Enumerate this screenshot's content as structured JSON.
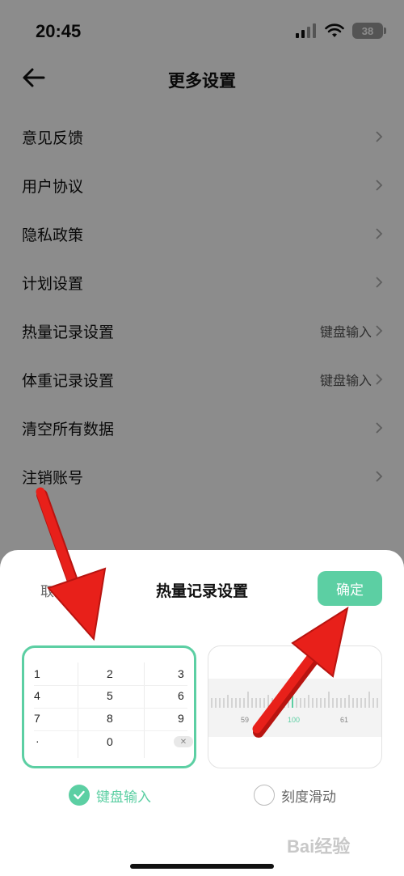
{
  "status_bar": {
    "time": "20:45",
    "battery": "38",
    "icons": [
      "signal-icon",
      "wifi-icon",
      "battery-icon"
    ]
  },
  "header": {
    "title": "更多设置",
    "back_icon": "back-arrow-icon"
  },
  "settings": [
    {
      "label": "意见反馈",
      "value": ""
    },
    {
      "label": "用户协议",
      "value": ""
    },
    {
      "label": "隐私政策",
      "value": ""
    },
    {
      "label": "计划设置",
      "value": ""
    },
    {
      "label": "热量记录设置",
      "value": "键盘输入"
    },
    {
      "label": "体重记录设置",
      "value": "键盘输入"
    },
    {
      "label": "清空所有数据",
      "value": ""
    },
    {
      "label": "注销账号",
      "value": ""
    }
  ],
  "sheet": {
    "cancel_label": "取消",
    "title": "热量记录设置",
    "confirm_label": "确定",
    "keypad_keys": [
      "1",
      "2",
      "3",
      "4",
      "5",
      "6",
      "7",
      "8",
      "9",
      "·",
      "0"
    ],
    "delete_key": "✕",
    "ruler_labels": [
      "59",
      "100",
      "61"
    ],
    "options": [
      {
        "label": "键盘输入",
        "selected": true
      },
      {
        "label": "刻度滑动",
        "selected": false
      }
    ]
  },
  "colors": {
    "accent": "#5ccfa3",
    "annotation_arrow": "#e8201a"
  },
  "watermark": "Bai经验"
}
